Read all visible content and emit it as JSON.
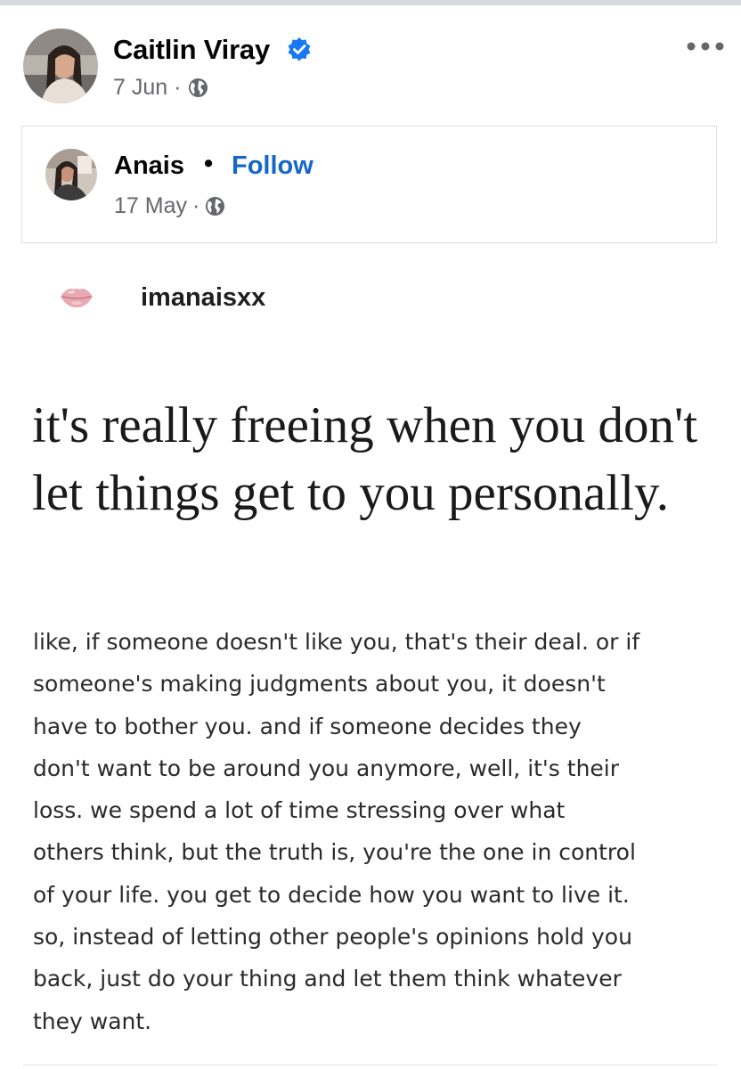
{
  "post": {
    "author_name": "Caitlin Viray",
    "date": "7 Jun",
    "separator": "·",
    "verified_icon": "verified-badge-icon",
    "audience_icon": "globe-icon",
    "menu_icon": "more-options-icon"
  },
  "shared_post": {
    "author_name": "Anais",
    "dot": "•",
    "follow_label": "Follow",
    "date": "17 May",
    "separator": "·",
    "audience_icon": "globe-icon"
  },
  "quote": {
    "icon": "lips-icon",
    "handle": "imanaisxx",
    "headline": "it's really freeing when you don't let things get to you personally.",
    "body": "like, if someone doesn't like you, that's their deal. or if\nsomeone's making judgments about you, it doesn't\nhave to bother you. and if someone decides they\ndon't want to be around you anymore, well, it's their\nloss. we spend a lot of time stressing over what\nothers think, but the truth is, you're the one in control\nof your life. you get to decide how you want to live it.\nso, instead of letting other people's opinions hold you\nback, just do your thing and let them think whatever\nthey want."
  },
  "colors": {
    "follow_link": "#1667c9",
    "verified_badge": "#1877f2",
    "meta_text": "#65676b",
    "card_border": "#dadde1"
  }
}
